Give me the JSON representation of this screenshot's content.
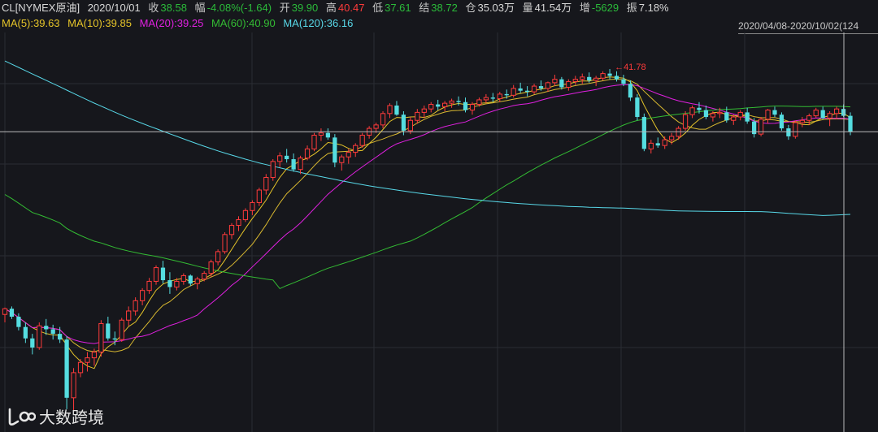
{
  "header": {
    "symbol": "CL[NYMEX原油]",
    "date": "2020/10/01",
    "close_label": "收",
    "close_value": "38.58",
    "change_label": "幅",
    "change_value": "-4.08%(-1.64)",
    "open_label": "开",
    "open_value": "39.90",
    "high_label": "高",
    "high_value": "40.47",
    "low_label": "低",
    "low_value": "37.61",
    "settle_label": "结",
    "settle_value": "38.72",
    "oi_label": "仓",
    "oi_value": "35.03万",
    "vol_label": "量",
    "vol_value": "41.54万",
    "inc_label": "增",
    "inc_value": "-5629",
    "amp_label": "振",
    "amp_value": "7.18%",
    "range": "2020/04/08-2020/10/02(124"
  },
  "ma_legend": [
    {
      "label": "MA(5):39.63",
      "color": "#e5c429"
    },
    {
      "label": "MA(10):39.85",
      "color": "#e5c429"
    },
    {
      "label": "MA(20):39.25",
      "color": "#e020e0"
    },
    {
      "label": "MA(60):40.90",
      "color": "#33bb33"
    },
    {
      "label": "MA(120):36.16",
      "color": "#58d8e8"
    }
  ],
  "chart_data": {
    "type": "candlestick",
    "x_range": [
      "2020/04/08",
      "2020/10/02"
    ],
    "candle_count": 124,
    "up_color": "#ff3b3b",
    "down_color": "#55dde0",
    "annotation": {
      "label": "41.78",
      "candle_index": 88
    },
    "ohlc": [
      [
        22.3,
        22.9,
        21.6,
        22.8
      ],
      [
        22.8,
        23.0,
        21.9,
        22.1
      ],
      [
        22.1,
        22.4,
        20.9,
        21.2
      ],
      [
        21.2,
        21.6,
        19.8,
        20.2
      ],
      [
        20.2,
        20.6,
        18.8,
        19.4
      ],
      [
        19.4,
        21.6,
        19.2,
        21.3
      ],
      [
        21.3,
        21.9,
        20.5,
        21.0
      ],
      [
        21.0,
        21.4,
        20.1,
        20.6
      ],
      [
        20.6,
        21.2,
        19.8,
        20.1
      ],
      [
        20.1,
        20.4,
        14.0,
        15.0
      ],
      [
        15.0,
        17.6,
        13.8,
        17.2
      ],
      [
        17.2,
        18.4,
        16.8,
        18.1
      ],
      [
        18.1,
        19.0,
        17.3,
        18.5
      ],
      [
        18.5,
        19.3,
        17.8,
        19.0
      ],
      [
        19.0,
        21.8,
        18.6,
        21.5
      ],
      [
        21.5,
        22.1,
        20.0,
        20.2
      ],
      [
        20.2,
        20.8,
        19.6,
        20.1
      ],
      [
        20.1,
        22.0,
        19.9,
        21.8
      ],
      [
        21.8,
        23.0,
        21.3,
        22.6
      ],
      [
        22.6,
        23.8,
        22.2,
        23.5
      ],
      [
        23.5,
        24.6,
        23.1,
        24.4
      ],
      [
        24.4,
        25.5,
        24.1,
        25.2
      ],
      [
        25.2,
        26.6,
        24.9,
        26.4
      ],
      [
        26.4,
        27.0,
        25.0,
        25.3
      ],
      [
        25.3,
        26.0,
        24.1,
        24.7
      ],
      [
        24.7,
        25.5,
        24.4,
        25.2
      ],
      [
        25.2,
        25.9,
        24.9,
        25.7
      ],
      [
        25.7,
        25.8,
        24.8,
        25.0
      ],
      [
        25.0,
        25.6,
        24.5,
        25.4
      ],
      [
        25.4,
        26.1,
        25.2,
        25.9
      ],
      [
        25.9,
        27.1,
        25.6,
        26.9
      ],
      [
        26.9,
        28.0,
        26.6,
        27.8
      ],
      [
        27.8,
        29.5,
        27.6,
        29.3
      ],
      [
        29.3,
        30.3,
        28.9,
        30.1
      ],
      [
        30.1,
        30.9,
        29.6,
        30.6
      ],
      [
        30.6,
        31.6,
        30.4,
        31.4
      ],
      [
        31.4,
        32.3,
        31.0,
        32.1
      ],
      [
        32.1,
        33.4,
        31.8,
        33.2
      ],
      [
        33.2,
        34.6,
        32.8,
        34.3
      ],
      [
        34.3,
        35.9,
        34.0,
        35.7
      ],
      [
        35.7,
        36.5,
        35.2,
        36.2
      ],
      [
        36.2,
        36.8,
        35.6,
        35.9
      ],
      [
        35.9,
        36.4,
        34.8,
        35.0
      ],
      [
        35.0,
        36.2,
        34.6,
        36.0
      ],
      [
        36.0,
        37.1,
        35.8,
        36.8
      ],
      [
        36.8,
        38.2,
        36.6,
        38.0
      ],
      [
        38.0,
        38.6,
        37.5,
        38.2
      ],
      [
        38.2,
        38.6,
        37.6,
        37.8
      ],
      [
        37.8,
        38.1,
        35.2,
        35.6
      ],
      [
        35.6,
        36.3,
        34.9,
        36.1
      ],
      [
        36.1,
        36.8,
        35.5,
        36.5
      ],
      [
        36.5,
        37.3,
        36.1,
        37.1
      ],
      [
        37.1,
        38.2,
        36.9,
        38.0
      ],
      [
        38.0,
        38.8,
        37.7,
        38.6
      ],
      [
        38.6,
        39.1,
        38.2,
        38.9
      ],
      [
        38.9,
        40.1,
        38.6,
        39.9
      ],
      [
        39.9,
        40.8,
        39.5,
        40.6
      ],
      [
        40.6,
        41.0,
        39.7,
        39.8
      ],
      [
        39.8,
        40.1,
        38.0,
        38.4
      ],
      [
        38.4,
        39.6,
        38.1,
        39.3
      ],
      [
        39.3,
        40.3,
        39.0,
        40.0
      ],
      [
        40.0,
        40.6,
        39.5,
        40.3
      ],
      [
        40.3,
        40.9,
        40.0,
        40.7
      ],
      [
        40.7,
        41.1,
        40.2,
        40.5
      ],
      [
        40.5,
        41.0,
        40.1,
        40.8
      ],
      [
        40.8,
        41.2,
        40.4,
        41.0
      ],
      [
        41.0,
        41.4,
        40.6,
        40.9
      ],
      [
        40.9,
        41.3,
        40.0,
        40.2
      ],
      [
        40.2,
        40.9,
        39.8,
        40.7
      ],
      [
        40.7,
        41.3,
        40.5,
        41.1
      ],
      [
        41.1,
        41.6,
        40.8,
        41.3
      ],
      [
        41.3,
        41.7,
        40.9,
        41.2
      ],
      [
        41.2,
        41.8,
        40.9,
        41.6
      ],
      [
        41.6,
        42.0,
        41.2,
        41.5
      ],
      [
        41.5,
        42.4,
        41.3,
        42.1
      ],
      [
        42.1,
        42.6,
        41.7,
        41.9
      ],
      [
        41.9,
        42.3,
        41.4,
        41.8
      ],
      [
        41.8,
        42.5,
        41.6,
        42.3
      ],
      [
        42.3,
        42.8,
        41.9,
        42.1
      ],
      [
        42.1,
        42.7,
        41.8,
        42.6
      ],
      [
        42.6,
        43.3,
        42.3,
        42.9
      ],
      [
        42.9,
        43.1,
        42.0,
        42.2
      ],
      [
        42.2,
        42.9,
        41.9,
        42.7
      ],
      [
        42.7,
        43.2,
        42.4,
        42.9
      ],
      [
        42.9,
        43.4,
        42.5,
        43.1
      ],
      [
        43.1,
        43.5,
        42.6,
        42.8
      ],
      [
        42.8,
        43.2,
        42.3,
        43.0
      ],
      [
        43.0,
        43.6,
        42.8,
        43.4
      ],
      [
        43.4,
        43.8,
        42.9,
        43.2
      ],
      [
        43.2,
        43.6,
        42.7,
        42.9
      ],
      [
        42.9,
        43.3,
        42.3,
        42.5
      ],
      [
        42.5,
        42.8,
        41.0,
        41.3
      ],
      [
        41.3,
        41.6,
        39.3,
        39.6
      ],
      [
        39.6,
        39.9,
        36.6,
        36.8
      ],
      [
        36.8,
        37.6,
        36.4,
        37.3
      ],
      [
        37.3,
        37.8,
        36.9,
        37.1
      ],
      [
        37.1,
        37.9,
        36.8,
        37.6
      ],
      [
        37.6,
        38.2,
        37.2,
        37.9
      ],
      [
        37.9,
        38.8,
        37.6,
        38.6
      ],
      [
        38.6,
        40.1,
        38.4,
        39.8
      ],
      [
        39.8,
        40.6,
        39.5,
        40.4
      ],
      [
        40.4,
        40.9,
        39.9,
        40.2
      ],
      [
        40.2,
        40.6,
        39.4,
        39.6
      ],
      [
        39.6,
        40.1,
        39.2,
        39.9
      ],
      [
        39.9,
        40.4,
        39.5,
        40.0
      ],
      [
        40.0,
        40.5,
        39.1,
        39.3
      ],
      [
        39.3,
        39.8,
        38.9,
        39.6
      ],
      [
        39.6,
        40.2,
        39.3,
        40.0
      ],
      [
        40.0,
        40.4,
        39.0,
        39.2
      ],
      [
        39.2,
        39.5,
        37.8,
        38.1
      ],
      [
        38.1,
        39.6,
        37.9,
        39.4
      ],
      [
        39.4,
        40.3,
        39.0,
        40.2
      ],
      [
        40.2,
        40.5,
        39.6,
        39.8
      ],
      [
        39.8,
        40.0,
        38.4,
        38.6
      ],
      [
        38.6,
        38.9,
        37.6,
        37.9
      ],
      [
        37.9,
        39.3,
        37.7,
        39.1
      ],
      [
        39.1,
        39.6,
        38.7,
        39.3
      ],
      [
        39.3,
        39.9,
        38.9,
        39.7
      ],
      [
        39.7,
        40.4,
        39.5,
        40.2
      ],
      [
        40.2,
        40.5,
        39.4,
        39.5
      ],
      [
        39.5,
        40.1,
        38.8,
        39.9
      ],
      [
        39.9,
        40.5,
        39.4,
        40.3
      ],
      [
        40.3,
        40.7,
        39.6,
        39.7
      ],
      [
        39.7,
        40.0,
        38.0,
        38.3
      ]
    ]
  },
  "watermark": {
    "text": "大数跨境"
  }
}
